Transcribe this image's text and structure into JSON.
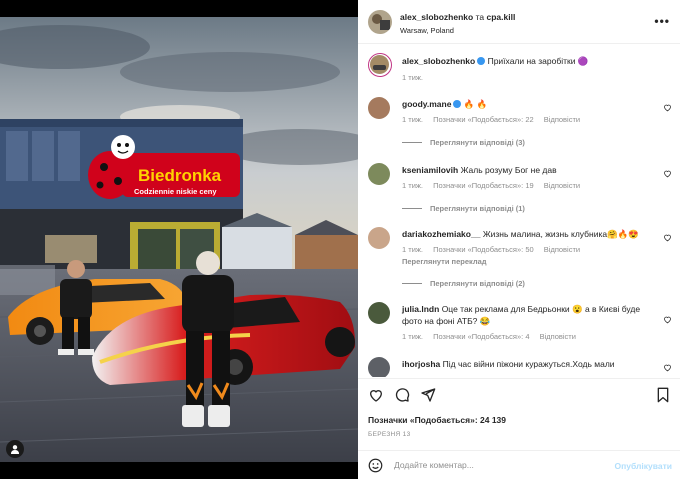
{
  "header": {
    "author": "alex_slobozhenko",
    "conjunction": "та",
    "coauthor": "cpa.kill",
    "location": "Warsaw, Poland"
  },
  "photo": {
    "store_name": "Biedronka",
    "store_tagline": "Codziennie niskie ceny"
  },
  "caption": {
    "username": "alex_slobozhenko",
    "text": "Приїхали на заробітки 🟣",
    "time": "1 тиж."
  },
  "comments": [
    {
      "username": "goody.mane",
      "text": "🔥 🔥",
      "time": "1 тиж.",
      "likes": "Позначки «Подобається»: 22",
      "reply": "Відповісти",
      "view_replies": "Переглянути відповіді (3)",
      "verified": true
    },
    {
      "username": "kseniamilovih",
      "text": "Жаль розуму Бог не дав",
      "time": "1 тиж.",
      "likes": "Позначки «Подобається»: 19",
      "reply": "Відповісти",
      "view_replies": "Переглянути відповіді (1)"
    },
    {
      "username": "dariakozhemiako__",
      "text": "Жизнь малина, жизнь клубника🤗🔥😍",
      "time": "1 тиж.",
      "likes": "Позначки «Подобається»: 50",
      "reply": "Відповісти",
      "translate": "Переглянути переклад",
      "view_replies": "Переглянути відповіді (2)"
    },
    {
      "username": "julia.lndn",
      "text": "Оце так реклама для Бедрьонки 😮 а в Києві буде фото на фоні АТБ? 😂",
      "time": "1 тиж.",
      "likes": "Позначки «Подобається»: 4",
      "reply": "Відповісти"
    },
    {
      "username": "ihorjosha",
      "text": "Під час війни піжони куражуться.Ходь мали"
    }
  ],
  "likes_count": "Позначки «Подобається»: 24 139",
  "post_date": "БЕРЕЗНЯ 13",
  "add_comment": {
    "placeholder": "Додайте коментар...",
    "post_label": "Опублікувати"
  },
  "colors": {
    "accent": "#3897f0",
    "post_disabled": "#b2dffc",
    "heart_red": "#ed4956",
    "store_red": "#d0021b",
    "store_yellow": "#ffd200"
  }
}
